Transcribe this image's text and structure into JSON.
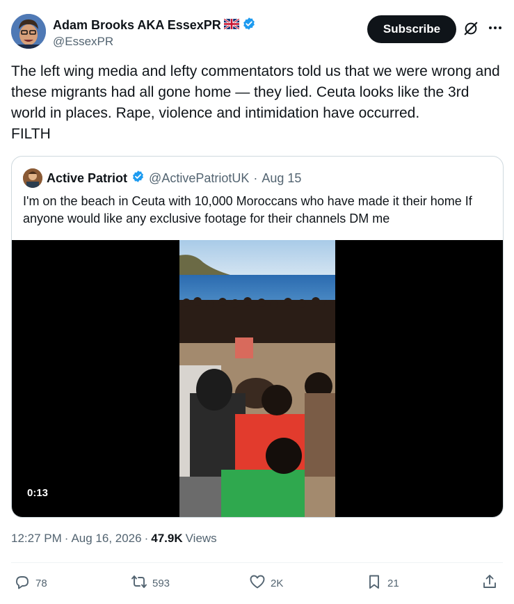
{
  "author": {
    "name": "Adam Brooks AKA EssexPR",
    "handle": "@EssexPR",
    "flag_icon": "uk-flag-icon",
    "verified_icon": "verified-badge-icon"
  },
  "header": {
    "subscribe_label": "Subscribe",
    "grok_icon": "grok-icon",
    "more_icon": "more-dots-icon"
  },
  "tweet": {
    "text": "The left wing media and lefty commentators told us that we were wrong and these migrants had all gone home — they lied. Ceuta looks like the 3rd world in places. Rape, violence and intimidation have occurred.\nFILTH"
  },
  "quote": {
    "name": "Active Patriot",
    "handle": "@ActivePatriotUK",
    "separator": "·",
    "date": "Aug 15",
    "text": "I'm on the beach in Ceuta with 10,000 Moroccans who have made it their home  If anyone would like any exclusive footage for their channels DM me",
    "video": {
      "duration": "0:13"
    }
  },
  "meta": {
    "time": "12:27 PM",
    "separator1": "·",
    "date": "Aug 16, 2026",
    "separator2": "·",
    "views_count": "47.9K",
    "views_label": "Views"
  },
  "actions": {
    "replies": "78",
    "reposts": "593",
    "likes": "2K",
    "bookmarks": "21"
  },
  "colors": {
    "text": "#0f1419",
    "secondary": "#536471",
    "verified": "#1d9bf0",
    "border": "#cfd9de"
  }
}
